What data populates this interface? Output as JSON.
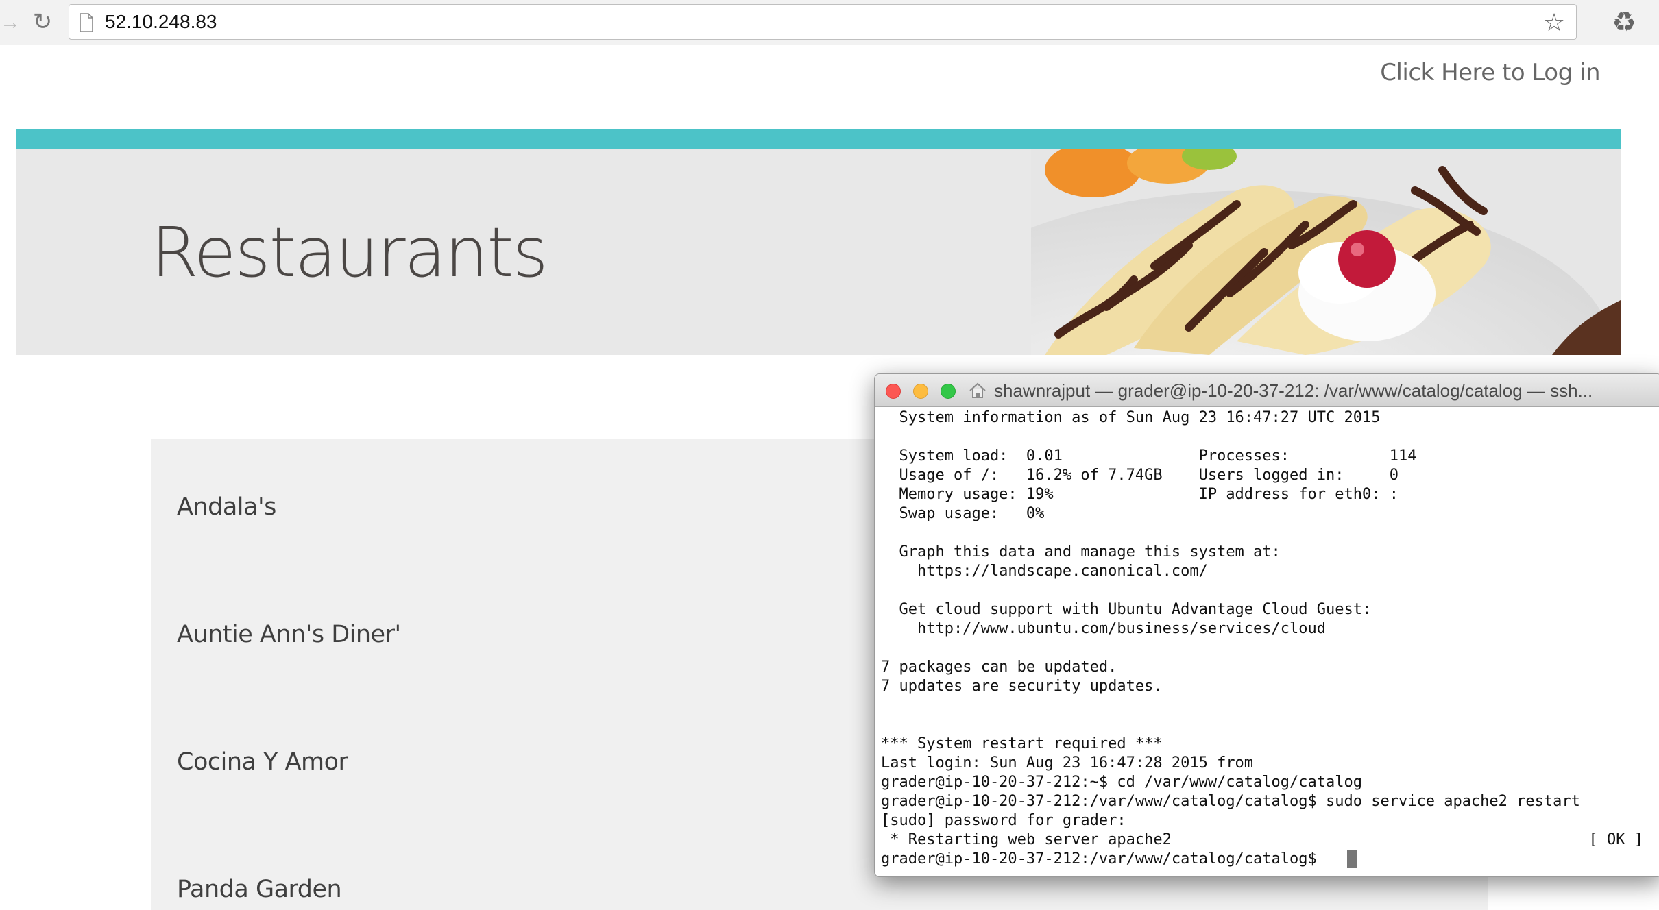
{
  "browser": {
    "url": "52.10.248.83",
    "icons": {
      "back": "forward-arrow-icon",
      "reload": "reload-icon",
      "page": "page-icon",
      "bookmark": "star-icon",
      "extension": "recycle-icon"
    }
  },
  "page": {
    "login_link": "Click Here to Log in",
    "banner_title": "Restaurants",
    "accent_color": "#4cc3c8",
    "restaurants": [
      "Andala's",
      "Auntie Ann's Diner'",
      "Cocina Y Amor",
      "Panda Garden"
    ]
  },
  "terminal": {
    "title": "shawnrajput — grader@ip-10-20-37-212: /var/www/catalog/catalog — ssh...",
    "lines": [
      "  System information as of Sun Aug 23 16:47:27 UTC 2015",
      "",
      "  System load:  0.01               Processes:           114",
      "  Usage of /:   16.2% of 7.74GB    Users logged in:     0",
      "  Memory usage: 19%                IP address for eth0: :",
      "  Swap usage:   0%",
      "",
      "  Graph this data and manage this system at:",
      "    https://landscape.canonical.com/",
      "",
      "  Get cloud support with Ubuntu Advantage Cloud Guest:",
      "    http://www.ubuntu.com/business/services/cloud",
      "",
      "7 packages can be updated.",
      "7 updates are security updates.",
      "",
      "",
      "*** System restart required ***",
      "Last login: Sun Aug 23 16:47:28 2015 from",
      "grader@ip-10-20-37-212:~$ cd /var/www/catalog/catalog",
      "grader@ip-10-20-37-212:/var/www/catalog/catalog$ sudo service apache2 restart",
      "[sudo] password for grader:",
      " * Restarting web server apache2",
      "grader@ip-10-20-37-212:/var/www/catalog/catalog$ "
    ],
    "ok_status": "[ OK ]"
  }
}
